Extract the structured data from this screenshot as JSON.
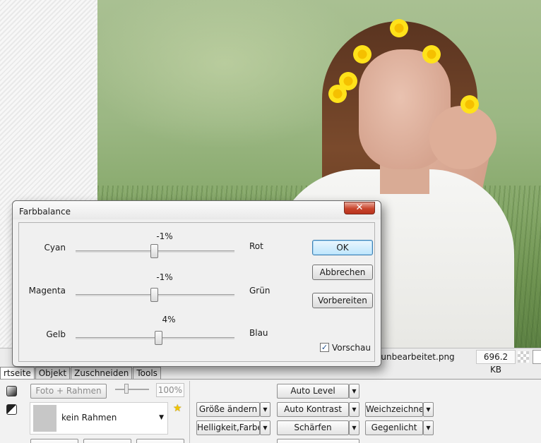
{
  "dialog": {
    "title": "Farbbalance",
    "close_icon": "close-icon",
    "sliders": [
      {
        "left_label": "Cyan",
        "right_label": "Rot",
        "value_text": "-1%",
        "value": -1
      },
      {
        "left_label": "Magenta",
        "right_label": "Grün",
        "value_text": "-1%",
        "value": -1
      },
      {
        "left_label": "Gelb",
        "right_label": "Blau",
        "value_text": "4%",
        "value": 4
      }
    ],
    "slider_range": [
      -100,
      100
    ],
    "buttons": {
      "ok": "OK",
      "cancel": "Abbrechen",
      "prepare": "Vorbereiten"
    },
    "preview": {
      "label": "Vorschau",
      "checked": true,
      "check_glyph": "✓"
    }
  },
  "status": {
    "filename": "eunbearbeitet.png",
    "filesize": "696.2 KB"
  },
  "tabs": [
    {
      "label": "rtseite",
      "active": true
    },
    {
      "label": "Objekt",
      "active": false
    },
    {
      "label": "Zuschneiden",
      "active": false
    },
    {
      "label": "Tools",
      "active": false
    }
  ],
  "toolbar": {
    "photo_frame": "Foto + Rahmen",
    "zoom_percent": "100%",
    "frame_select": "kein Rahmen",
    "dropdown_glyph": "▼",
    "star_glyph": "★",
    "resize": "Größe ändern",
    "brightness_color": "Helligkeit,Farbe",
    "auto_level": "Auto Level",
    "auto_contrast": "Auto Kontrast",
    "sharpen": "Schärfen",
    "soften": "Weichzeichner",
    "backlight": "Gegenlicht"
  },
  "icons": [
    "close-icon",
    "star-icon",
    "checkerboard-icon",
    "gradient-square-icon",
    "contrast-icon"
  ]
}
